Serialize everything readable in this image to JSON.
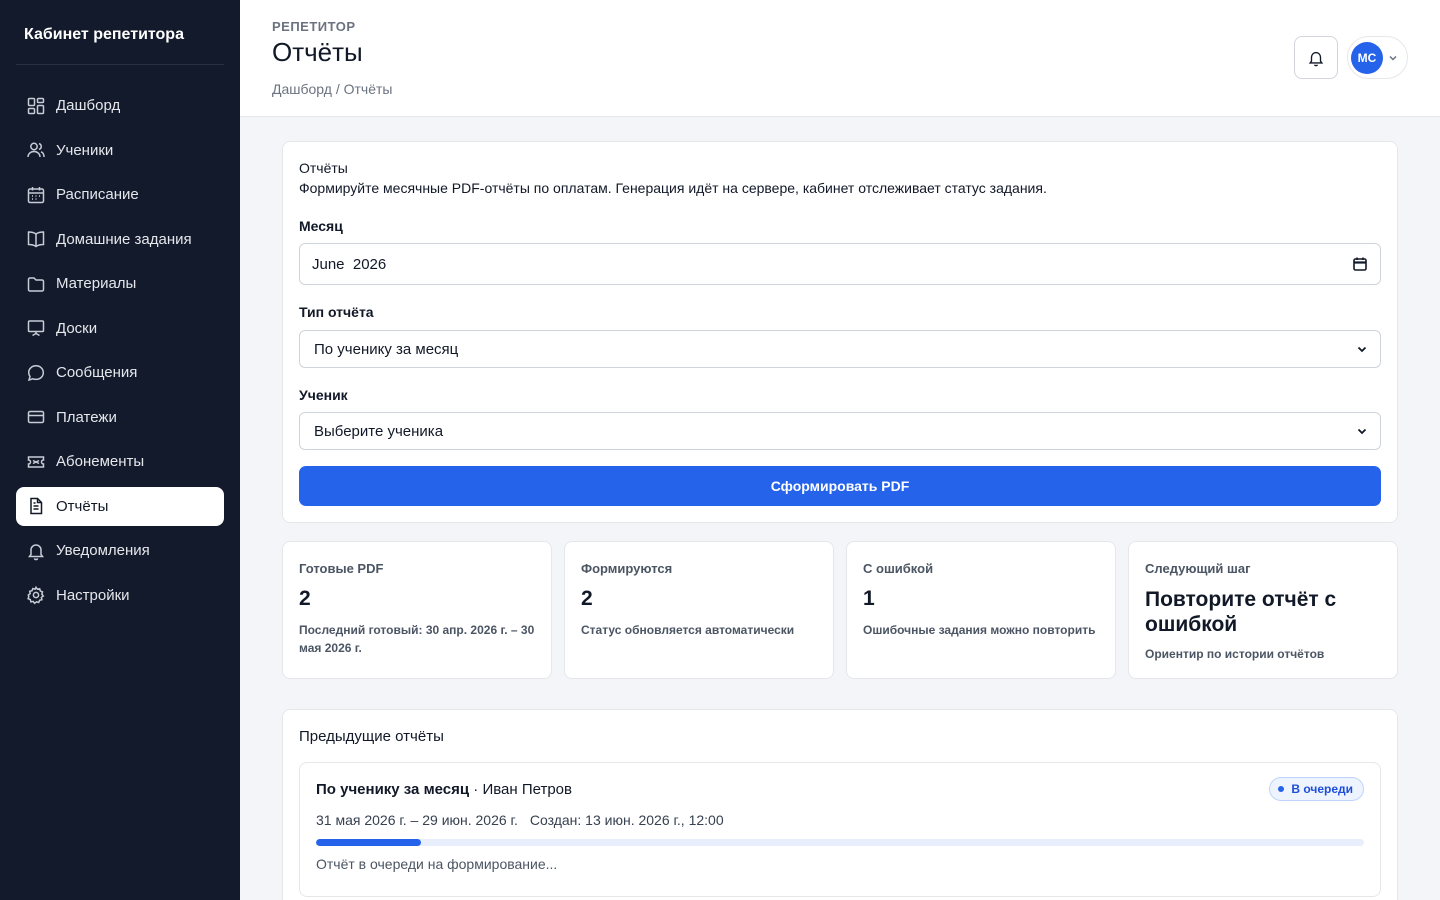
{
  "sidebar": {
    "brand": "Кабинет репетитора",
    "items": [
      {
        "label": "Дашборд",
        "icon": "dashboard-icon",
        "active": false
      },
      {
        "label": "Ученики",
        "icon": "users-icon",
        "active": false
      },
      {
        "label": "Расписание",
        "icon": "calendar-icon",
        "active": false
      },
      {
        "label": "Домашние задания",
        "icon": "book-icon",
        "active": false
      },
      {
        "label": "Материалы",
        "icon": "folder-icon",
        "active": false
      },
      {
        "label": "Доски",
        "icon": "board-icon",
        "active": false
      },
      {
        "label": "Сообщения",
        "icon": "chat-icon",
        "active": false
      },
      {
        "label": "Платежи",
        "icon": "card-icon",
        "active": false
      },
      {
        "label": "Абонементы",
        "icon": "ticket-icon",
        "active": false
      },
      {
        "label": "Отчёты",
        "icon": "report-icon",
        "active": true
      },
      {
        "label": "Уведомления",
        "icon": "bell-icon",
        "active": false
      },
      {
        "label": "Настройки",
        "icon": "gear-icon",
        "active": false
      }
    ]
  },
  "header": {
    "eyebrow": "РЕПЕТИТОР",
    "title": "Отчёты",
    "breadcrumb": "Дашборд / Отчёты",
    "avatar_initials": "МС"
  },
  "form": {
    "title": "Отчёты",
    "description": "Формируйте месячные PDF-отчёты по оплатам. Генерация идёт на сервере, кабинет отслеживает статус задания.",
    "month_label": "Месяц",
    "month_value": "June  2026",
    "type_label": "Тип отчёта",
    "type_value": "По ученику за месяц",
    "student_label": "Ученик",
    "student_value": "Выберите ученика",
    "submit_label": "Сформировать PDF"
  },
  "stats": [
    {
      "label": "Готовые PDF",
      "value": "2",
      "note": "Последний готовый: 30 апр. 2026 г. – 30 мая 2026 г."
    },
    {
      "label": "Формируются",
      "value": "2",
      "note": "Статус обновляется автоматически"
    },
    {
      "label": "С ошибкой",
      "value": "1",
      "note": "Ошибочные задания можно повторить"
    },
    {
      "label": "Следующий шаг",
      "value": "Повторите отчёт с ошибкой",
      "note": "Ориентир по истории отчётов"
    }
  ],
  "history": {
    "title": "Предыдущие отчёты",
    "jobs": [
      {
        "type": "По ученику за месяц",
        "student": " · Иван Петров",
        "badge": "В очереди",
        "period": "31 мая 2026 г. – 29 июн. 2026 г.",
        "created": "Создан: 13 июн. 2026 г., 12:00",
        "progress": 0.1,
        "status": "Отчёт в очереди на формирование..."
      }
    ]
  },
  "colors": {
    "accent": "#2563eb",
    "sidebar_bg": "#121a2c"
  }
}
